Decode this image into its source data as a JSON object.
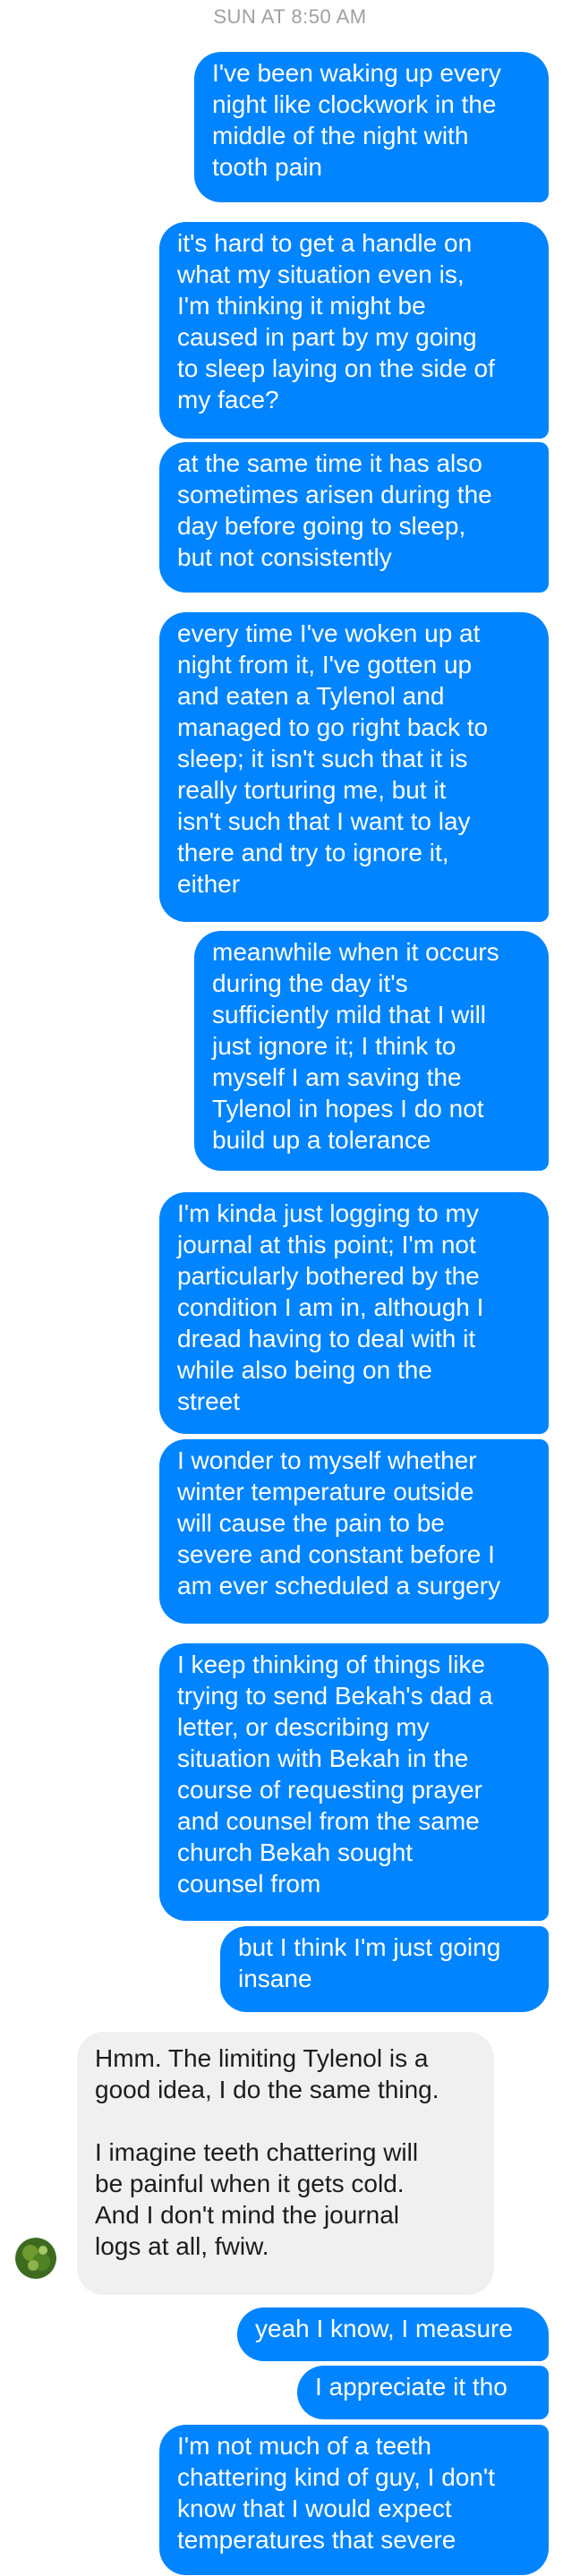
{
  "conversation": {
    "timestamp": "SUN AT 8:50 AM",
    "messages": [
      {
        "sender": "me",
        "text": "I've been waking up every\nnight like clockwork in the\nmiddle of the night with\ntooth pain"
      },
      {
        "sender": "me",
        "text": "it's hard to get a handle on\nwhat my situation even is,\nI'm thinking it might be\ncaused in part by my going\nto sleep laying on the side of\nmy face?"
      },
      {
        "sender": "me",
        "text": "at the same time it has also\nsometimes arisen during the\nday before going to sleep,\nbut not consistently"
      },
      {
        "sender": "me",
        "text": "every time I've woken up at\nnight from it, I've gotten up\nand eaten a Tylenol and\nmanaged to go right back to\nsleep; it isn't such that it is\nreally torturing me, but it\nisn't such that I want to lay\nthere and try to ignore it,\neither"
      },
      {
        "sender": "me",
        "text": "meanwhile when it occurs\nduring the day it's\nsufficiently mild that I will\njust ignore it; I think to\nmyself I am saving the\nTylenol in hopes I do not\nbuild up a tolerance"
      },
      {
        "sender": "me",
        "text": "I'm kinda just logging to my\njournal at this point; I'm not\nparticularly bothered by the\ncondition I am in, although I\ndread having to deal with it\nwhile also being on the\nstreet"
      },
      {
        "sender": "me",
        "text": "I wonder to myself whether\nwinter temperature outside\nwill cause the pain to be\nsevere and constant before I\nam ever scheduled a surgery"
      },
      {
        "sender": "me",
        "text": "I keep thinking of things like\ntrying to send Bekah's dad a\nletter, or describing my\nsituation with Bekah in the\ncourse of requesting prayer\nand counsel from the same\nchurch Bekah sought\ncounsel from"
      },
      {
        "sender": "me",
        "text": "but I think I'm just going\ninsane"
      },
      {
        "sender": "them",
        "text": "Hmm. The limiting Tylenol is a\ngood idea, I do the same thing.\n\nI imagine teeth chattering will\nbe painful when it gets cold.\nAnd I don't mind the journal\nlogs at all, fwiw."
      },
      {
        "sender": "me",
        "text": "yeah I know, I measure"
      },
      {
        "sender": "me",
        "text": "I appreciate it tho"
      },
      {
        "sender": "me",
        "text": "I'm not much of a teeth\nchattering kind of guy, I don't\nknow that I would expect\ntemperatures that severe"
      }
    ]
  },
  "colors": {
    "outgoing_bubble": "#0084ff",
    "incoming_bubble": "#f0f0f0",
    "timestamp_text": "#a0a0a0"
  },
  "avatar": {
    "icon": "avatar-photo-icon"
  }
}
